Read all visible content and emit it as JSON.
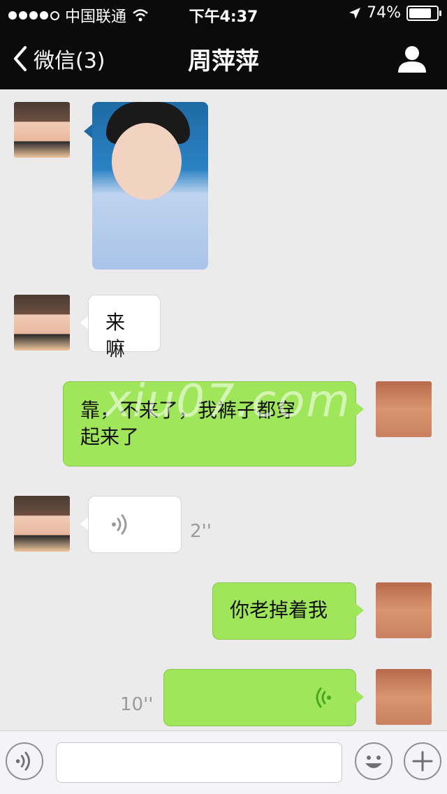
{
  "status_bar": {
    "carrier": "中国联通",
    "time": "下午4:37",
    "battery": "74%"
  },
  "nav": {
    "back_label": "微信(3)",
    "title": "周萍萍"
  },
  "messages": [
    {
      "text": "来嘛"
    },
    {
      "text_line1": "靠，不来了，我裤子都穿",
      "text_line2": "起来了"
    },
    {
      "duration": "2''"
    },
    {
      "text": "你老掉着我"
    },
    {
      "duration": "10''"
    }
  ],
  "watermark": "xiu07.com",
  "colors": {
    "green_bubble": "#9fe65a",
    "topbar": "#0b0b0b",
    "chat_bg": "#ebebeb"
  }
}
